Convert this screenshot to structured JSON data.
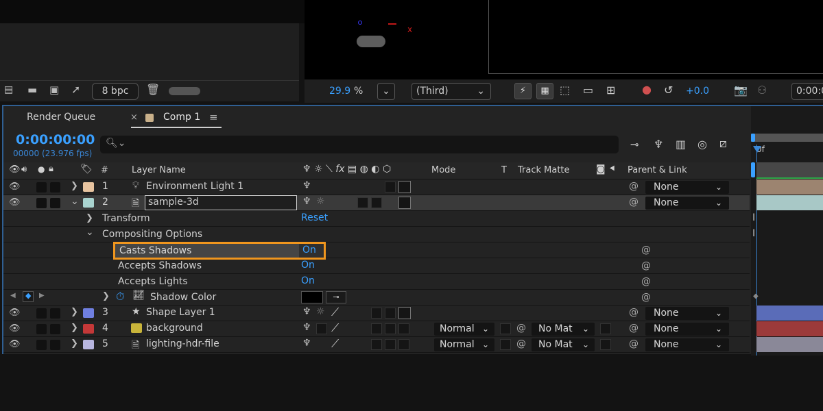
{
  "project_toolbar": {
    "bpc": "8 bpc"
  },
  "viewer_toolbar": {
    "zoom_value": "29.9",
    "zoom_unit": "%",
    "view_select": "(Third)",
    "exposure": "+0.0",
    "time": "0:00:0"
  },
  "tabs": {
    "render_queue": "Render Queue",
    "comp": "Comp 1",
    "close": "×",
    "menu": "≡"
  },
  "timecode": {
    "main": "0:00:00:00",
    "sub": "00000 (23.976 fps)"
  },
  "search": {
    "placeholder": ""
  },
  "columns": {
    "num": "#",
    "layer_name": "Layer Name",
    "mode": "Mode",
    "t": "T",
    "track_matte": "Track Matte",
    "parent": "Parent & Link",
    "ruler": "0f"
  },
  "layers": [
    {
      "num": "1",
      "name": "Environment Light 1",
      "color": "#e8c4a0",
      "parent": "None"
    },
    {
      "num": "2",
      "name": "sample-3d",
      "color": "#a9d3cf",
      "parent": "None"
    },
    {
      "num": "3",
      "name": "Shape Layer 1",
      "color": "#6f7fe0",
      "parent": "None",
      "mode": "",
      "matte": ""
    },
    {
      "num": "4",
      "name": "background",
      "color": "#c43838",
      "parent": "None",
      "mode": "Normal",
      "matte": "No Mat"
    },
    {
      "num": "5",
      "name": "lighting-hdr-file",
      "color": "#b8b6e0",
      "parent": "None",
      "mode": "Normal",
      "matte": "No Mat"
    }
  ],
  "properties": {
    "transform": "Transform",
    "reset": "Reset",
    "compositing": "Compositing Options",
    "casts_shadows": "Casts Shadows",
    "casts_value": "On",
    "accepts_shadows": "Accepts Shadows",
    "accepts_shadows_value": "On",
    "accepts_lights": "Accepts Lights",
    "accepts_lights_value": "On",
    "shadow_color": "Shadow Color"
  },
  "colors": {
    "accent_blue": "#3aa0ff",
    "highlight_orange": "#f0961e",
    "panel_bg": "#232323",
    "layer_bar_1": "#9c8470",
    "layer_bar_2": "#a8c8c6",
    "layer_bar_3": "#5a6cb8",
    "layer_bar_4": "#9c3a3a",
    "layer_bar_5": "#8a8898"
  }
}
